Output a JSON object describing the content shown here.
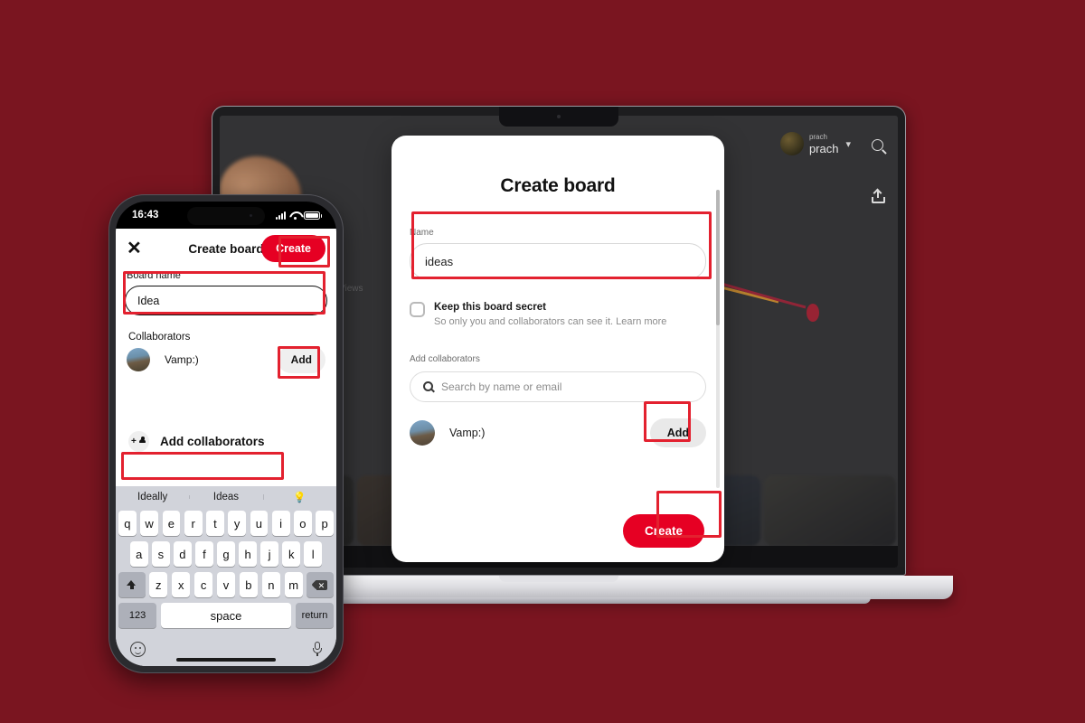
{
  "background": {
    "color": "#7a1520"
  },
  "desktop": {
    "app_bar": {
      "profile_handle": "prach",
      "profile_name": "prach",
      "chevron_icon": "chevron-down-icon",
      "search_icon": "search-icon",
      "share_icon": "share-icon"
    },
    "background_label": "Views",
    "modal": {
      "title": "Create board",
      "name_label": "Name",
      "name_value": "ideas",
      "secret_title": "Keep this board secret",
      "secret_subtitle": "So only you and collaborators can see it. Learn more",
      "collaborators_label": "Add collaborators",
      "search_placeholder": "Search by name or email",
      "collaborator_name": "Vamp:)",
      "add_label": "Add",
      "create_label": "Create"
    }
  },
  "phone": {
    "status": {
      "time": "16:43",
      "signal_icon": "cellular-signal-icon",
      "wifi_icon": "wifi-icon",
      "battery_icon": "battery-full-icon"
    },
    "header": {
      "close_icon": "close-icon",
      "title": "Create board",
      "create_label": "Create"
    },
    "board_name_label": "Board name",
    "board_name_value": "Idea",
    "collaborators_label": "Collaborators",
    "collaborator_name": "Vamp:)",
    "add_label": "Add",
    "add_collaborators_label": "Add collaborators",
    "add_collaborators_icon": "add-person-icon",
    "keyboard": {
      "suggestions": [
        "Ideally",
        "Ideas",
        "💡"
      ],
      "row1": [
        "q",
        "w",
        "e",
        "r",
        "t",
        "y",
        "u",
        "i",
        "o",
        "p"
      ],
      "row2": [
        "a",
        "s",
        "d",
        "f",
        "g",
        "h",
        "j",
        "k",
        "l"
      ],
      "row3": [
        "z",
        "x",
        "c",
        "v",
        "b",
        "n",
        "m"
      ],
      "shift_icon": "shift-icon",
      "backspace_icon": "backspace-icon",
      "numbers_label": "123",
      "space_label": "space",
      "return_label": "return",
      "emoji_icon": "emoji-icon",
      "mic_icon": "microphone-icon"
    }
  },
  "annotations": {
    "color": "#e3212f"
  }
}
